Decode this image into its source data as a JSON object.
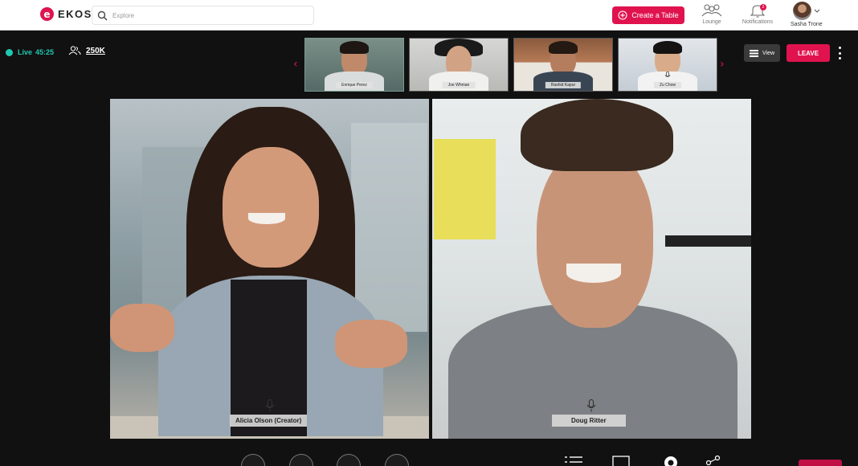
{
  "header": {
    "logo_text": "EKOS",
    "logo_icon": "ekos-logo-icon",
    "search": {
      "placeholder": "Explore",
      "value": ""
    },
    "create_button": "Create a Table",
    "nav": {
      "lounge": "Lounge",
      "notifications": "Notifications",
      "notification_count": "2"
    },
    "user": {
      "name": "Sasha Trone"
    }
  },
  "session": {
    "live_label": "Live",
    "elapsed": "45:25",
    "viewers": "250K"
  },
  "participants_strip": [
    {
      "name": "Enrique Perez"
    },
    {
      "name": "Joe Whman"
    },
    {
      "name": "Rashid Kapur"
    },
    {
      "name": "Zu Chow"
    }
  ],
  "controls": {
    "view_label": "View",
    "leave_label": "LEAVE"
  },
  "main_tiles": [
    {
      "name": "Alicia Olson (Creator)"
    },
    {
      "name": "Doug Ritter"
    }
  ],
  "colors": {
    "accent": "#e0134f",
    "live": "#21c8b0",
    "background": "#111111"
  }
}
